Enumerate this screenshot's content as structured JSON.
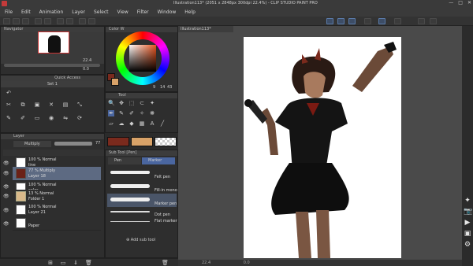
{
  "window": {
    "title": "Illustration113* (2051 x 2848px 300dpi 22.4%) - CLIP STUDIO PAINT PRO",
    "controls": [
      "—",
      "□",
      "✕"
    ]
  },
  "menu": [
    "File",
    "Edit",
    "Animation",
    "Layer",
    "Select",
    "View",
    "Filter",
    "Window",
    "Help"
  ],
  "navigator": {
    "title": "Navigator",
    "zoom": "22.4",
    "angle": "0.0"
  },
  "color_panel": {
    "title": "Color W",
    "main_color": "#7a2a1d",
    "sub_color": "#d8a268",
    "readouts": [
      "9",
      "14",
      "43"
    ]
  },
  "subview": {
    "title": "Quick Access",
    "set_label": "Set 1"
  },
  "tool": {
    "title": "Tool"
  },
  "subtool": {
    "title": "Sub Tool [Pen]",
    "tab_pen": "Pen",
    "tab_marker": "Marker",
    "items": [
      {
        "label": "Felt pen"
      },
      {
        "label": "Fill-in mono pen"
      },
      {
        "label": "Marker pen 1"
      },
      {
        "label": "Dot pen"
      },
      {
        "label": "Flat marker"
      }
    ],
    "add_label": "Add sub tool",
    "color_swatches": [
      "#7a2a1d",
      "#d8a268"
    ]
  },
  "layer_panel": {
    "title": "Layer",
    "blend_mode": "Multiply",
    "opacity": "77",
    "layers": [
      {
        "line1": "100 % Normal",
        "line2": "line"
      },
      {
        "line1": "77 % Multiply",
        "line2": "Layer 18"
      },
      {
        "line1": "100 % Normal",
        "line2": "color"
      },
      {
        "line1": "13 % Normal",
        "line2": "Folder 1"
      },
      {
        "line1": "100 % Normal",
        "line2": "Layer 21"
      },
      {
        "line1": "",
        "line2": "Paper"
      }
    ]
  },
  "canvas": {
    "tab_label": "Illustration113*"
  },
  "status": {
    "zoom": "22.4",
    "angle": "0.0"
  }
}
